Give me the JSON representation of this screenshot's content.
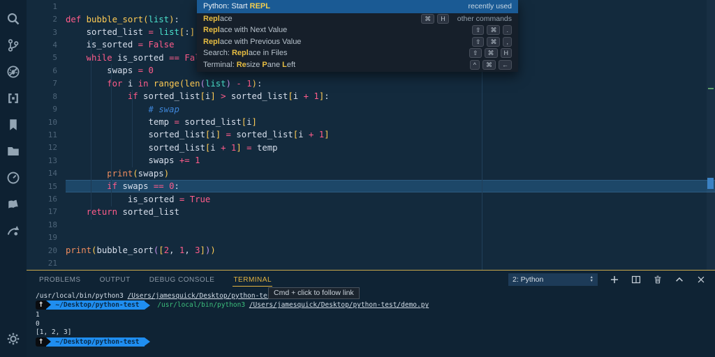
{
  "colors": {
    "editor_bg": "#132a3d",
    "activity_bg": "#0e2132",
    "panel_bg": "#0f2334",
    "panel_border_gold": "#c9a94c",
    "palette_bg": "#161f2a",
    "palette_selected_blue": "#1a5a94",
    "match_gold": "#e7bd42",
    "keyword_pink": "#ff5c8a",
    "bracket_yellow": "#ffcb54",
    "builtin_teal": "#4be0cb",
    "comment_blue": "#3d84d6",
    "print_orange": "#f08d5e",
    "terminal_green": "#3cbf7c",
    "prompt_blue": "#1f8ef0",
    "current_line": "#1d4768"
  },
  "activity_bar": {
    "icons": [
      {
        "name": "search-icon"
      },
      {
        "name": "source-control-icon"
      },
      {
        "name": "debug-icon"
      },
      {
        "name": "extensions-icon"
      },
      {
        "name": "bookmarks-icon"
      },
      {
        "name": "folder-icon"
      },
      {
        "name": "clock-icon"
      },
      {
        "name": "book-icon"
      },
      {
        "name": "share-icon"
      }
    ],
    "manage": {
      "name": "gear-icon"
    }
  },
  "editor": {
    "current_line": 15,
    "lines": [
      {
        "n": 1,
        "tokens": []
      },
      {
        "n": 2,
        "tokens": [
          [
            "def ",
            "k"
          ],
          [
            "bubble_sort",
            "y"
          ],
          [
            "(",
            "y"
          ],
          [
            "list",
            "t"
          ],
          [
            ")",
            "y"
          ],
          [
            ":",
            "w"
          ]
        ]
      },
      {
        "n": 3,
        "tokens": [
          [
            "    sorted_list ",
            "w"
          ],
          [
            "=",
            "k"
          ],
          [
            " ",
            "w"
          ],
          [
            "list",
            "t"
          ],
          [
            "[",
            "y"
          ],
          [
            ":",
            "w"
          ],
          [
            "]",
            "y"
          ]
        ]
      },
      {
        "n": 4,
        "tokens": [
          [
            "    is_sorted ",
            "w"
          ],
          [
            "=",
            "k"
          ],
          [
            " ",
            "w"
          ],
          [
            "False",
            "k"
          ]
        ]
      },
      {
        "n": 5,
        "tokens": [
          [
            "    ",
            "w"
          ],
          [
            "while",
            "k"
          ],
          [
            " is_sorted ",
            "w"
          ],
          [
            "==",
            "k"
          ],
          [
            " ",
            "w"
          ],
          [
            "False",
            "k"
          ],
          [
            ":",
            "w"
          ]
        ]
      },
      {
        "n": 6,
        "tokens": [
          [
            "        swaps ",
            "w"
          ],
          [
            "=",
            "k"
          ],
          [
            " ",
            "w"
          ],
          [
            "0",
            "k"
          ]
        ]
      },
      {
        "n": 7,
        "tokens": [
          [
            "        ",
            "w"
          ],
          [
            "for",
            "k"
          ],
          [
            " i ",
            "w"
          ],
          [
            "in",
            "k"
          ],
          [
            " ",
            "w"
          ],
          [
            "range",
            "y"
          ],
          [
            "(",
            "y"
          ],
          [
            "len",
            "y"
          ],
          [
            "(",
            "p"
          ],
          [
            "list",
            "t"
          ],
          [
            ")",
            "p"
          ],
          [
            " ",
            "w"
          ],
          [
            "-",
            "k"
          ],
          [
            " ",
            "w"
          ],
          [
            "1",
            "k"
          ],
          [
            ")",
            "y"
          ],
          [
            ":",
            "w"
          ]
        ]
      },
      {
        "n": 8,
        "tokens": [
          [
            "            ",
            "w"
          ],
          [
            "if",
            "k"
          ],
          [
            " sorted_list",
            "w"
          ],
          [
            "[",
            "y"
          ],
          [
            "i",
            "w"
          ],
          [
            "]",
            "y"
          ],
          [
            " ",
            "w"
          ],
          [
            ">",
            "k"
          ],
          [
            " sorted_list",
            "w"
          ],
          [
            "[",
            "y"
          ],
          [
            "i ",
            "w"
          ],
          [
            "+",
            "k"
          ],
          [
            " ",
            "w"
          ],
          [
            "1",
            "k"
          ],
          [
            "]",
            "y"
          ],
          [
            ":",
            "w"
          ]
        ]
      },
      {
        "n": 9,
        "tokens": [
          [
            "                ",
            "w"
          ],
          [
            "# swap",
            "c"
          ]
        ]
      },
      {
        "n": 10,
        "tokens": [
          [
            "                temp ",
            "w"
          ],
          [
            "=",
            "k"
          ],
          [
            " sorted_list",
            "w"
          ],
          [
            "[",
            "y"
          ],
          [
            "i",
            "w"
          ],
          [
            "]",
            "y"
          ]
        ]
      },
      {
        "n": 11,
        "tokens": [
          [
            "                sorted_list",
            "w"
          ],
          [
            "[",
            "y"
          ],
          [
            "i",
            "w"
          ],
          [
            "]",
            "y"
          ],
          [
            " ",
            "w"
          ],
          [
            "=",
            "k"
          ],
          [
            " sorted_list",
            "w"
          ],
          [
            "[",
            "y"
          ],
          [
            "i ",
            "w"
          ],
          [
            "+",
            "k"
          ],
          [
            " ",
            "w"
          ],
          [
            "1",
            "k"
          ],
          [
            "]",
            "y"
          ]
        ]
      },
      {
        "n": 12,
        "tokens": [
          [
            "                sorted_list",
            "w"
          ],
          [
            "[",
            "y"
          ],
          [
            "i ",
            "w"
          ],
          [
            "+",
            "k"
          ],
          [
            " ",
            "w"
          ],
          [
            "1",
            "k"
          ],
          [
            "]",
            "y"
          ],
          [
            " ",
            "w"
          ],
          [
            "=",
            "k"
          ],
          [
            " temp",
            "w"
          ]
        ]
      },
      {
        "n": 13,
        "tokens": [
          [
            "                swaps ",
            "w"
          ],
          [
            "+=",
            "k"
          ],
          [
            " ",
            "w"
          ],
          [
            "1",
            "k"
          ]
        ]
      },
      {
        "n": 14,
        "tokens": [
          [
            "        ",
            "w"
          ],
          [
            "print",
            "o"
          ],
          [
            "(",
            "y"
          ],
          [
            "swaps",
            "w"
          ],
          [
            ")",
            "y"
          ]
        ]
      },
      {
        "n": 15,
        "tokens": [
          [
            "        ",
            "w"
          ],
          [
            "if",
            "k"
          ],
          [
            " swaps ",
            "w"
          ],
          [
            "==",
            "k"
          ],
          [
            " ",
            "w"
          ],
          [
            "0",
            "k"
          ],
          [
            ":",
            "w"
          ]
        ]
      },
      {
        "n": 16,
        "tokens": [
          [
            "            is_sorted ",
            "w"
          ],
          [
            "=",
            "k"
          ],
          [
            " ",
            "w"
          ],
          [
            "True",
            "k"
          ]
        ]
      },
      {
        "n": 17,
        "tokens": [
          [
            "    ",
            "w"
          ],
          [
            "return",
            "k"
          ],
          [
            " sorted_list",
            "w"
          ]
        ]
      },
      {
        "n": 18,
        "tokens": []
      },
      {
        "n": 19,
        "tokens": []
      },
      {
        "n": 20,
        "tokens": [
          [
            "print",
            "o"
          ],
          [
            "(",
            "y"
          ],
          [
            "bubble_sort",
            "w"
          ],
          [
            "(",
            "p"
          ],
          [
            "[",
            "y"
          ],
          [
            "2",
            "k"
          ],
          [
            ", ",
            "w"
          ],
          [
            "1",
            "k"
          ],
          [
            ", ",
            "w"
          ],
          [
            "3",
            "k"
          ],
          [
            "]",
            "y"
          ],
          [
            ")",
            "p"
          ],
          [
            ")",
            "y"
          ]
        ]
      },
      {
        "n": 21,
        "tokens": []
      }
    ]
  },
  "palette": {
    "rows": [
      {
        "selected": true,
        "segments": [
          [
            "Python: Start ",
            "n"
          ],
          [
            "REPL",
            "m"
          ]
        ],
        "keys": [],
        "right_label": "recently used"
      },
      {
        "segments": [
          [
            "Repl",
            "m"
          ],
          [
            "ace",
            "n"
          ]
        ],
        "keys": [
          "⌘",
          "H"
        ],
        "right_label": "other commands"
      },
      {
        "segments": [
          [
            "Repl",
            "m"
          ],
          [
            "ace with Next Value",
            "n"
          ]
        ],
        "keys": [
          "⇧",
          "⌘",
          "."
        ]
      },
      {
        "segments": [
          [
            "Repl",
            "m"
          ],
          [
            "ace with Previous Value",
            "n"
          ]
        ],
        "keys": [
          "⇧",
          "⌘",
          ","
        ]
      },
      {
        "segments": [
          [
            "Search: ",
            "n"
          ],
          [
            "Repl",
            "m"
          ],
          [
            "ace in Files",
            "n"
          ]
        ],
        "keys": [
          "⇧",
          "⌘",
          "H"
        ]
      },
      {
        "segments": [
          [
            "Terminal: ",
            "n"
          ],
          [
            "Re",
            "m"
          ],
          [
            "size ",
            "n"
          ],
          [
            "P",
            "m"
          ],
          [
            "ane ",
            "n"
          ],
          [
            "L",
            "m"
          ],
          [
            "eft",
            "n"
          ]
        ],
        "keys": [
          "^",
          "⌘",
          "←"
        ]
      }
    ]
  },
  "panel": {
    "tabs": [
      {
        "label": "PROBLEMS",
        "active": false
      },
      {
        "label": "OUTPUT",
        "active": false
      },
      {
        "label": "DEBUG CONSOLE",
        "active": false
      },
      {
        "label": "TERMINAL",
        "active": true
      }
    ],
    "terminal_select": "2: Python",
    "actions": [
      {
        "name": "new-terminal-icon"
      },
      {
        "name": "split-terminal-icon"
      },
      {
        "name": "kill-terminal-icon"
      },
      {
        "name": "maximize-panel-icon"
      },
      {
        "name": "close-panel-icon"
      }
    ],
    "tooltip": "Cmd + click to follow link",
    "prompt": {
      "glyph": "†",
      "path": "~/Desktop/python-test"
    },
    "terminal_lines": [
      {
        "tokens": [
          [
            "/usr/local/bin/python3 ",
            "fg"
          ],
          [
            "/Users/jamesquick/Desktop/python-test",
            "link"
          ]
        ]
      },
      {
        "prompt": true,
        "tokens": [
          [
            " /usr/local/bin/python3 ",
            "green"
          ],
          [
            "/Users/jamesquick/Desktop/python-test/demo.py",
            "link"
          ]
        ]
      },
      {
        "tokens": [
          [
            "1",
            "fg"
          ]
        ]
      },
      {
        "tokens": [
          [
            "0",
            "fg"
          ]
        ]
      },
      {
        "tokens": [
          [
            "[1, 2, 3]",
            "fg"
          ]
        ]
      },
      {
        "prompt": true,
        "tokens": []
      }
    ]
  }
}
